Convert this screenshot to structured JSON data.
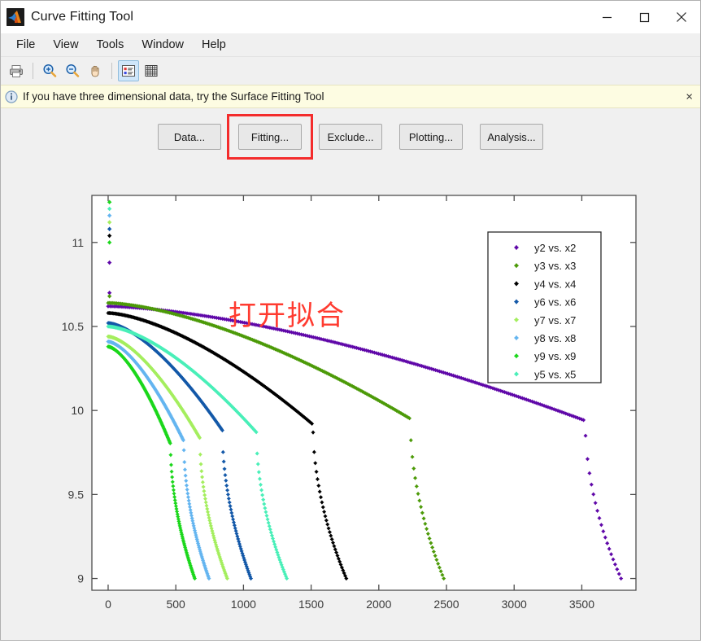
{
  "window": {
    "title": "Curve Fitting Tool",
    "app_icon": "matlab-logo-icon",
    "controls": {
      "minimize": "minimize-icon",
      "maximize": "maximize-icon",
      "close": "close-icon"
    }
  },
  "menubar": {
    "items": [
      {
        "label": "File"
      },
      {
        "label": "View"
      },
      {
        "label": "Tools"
      },
      {
        "label": "Window"
      },
      {
        "label": "Help"
      }
    ]
  },
  "toolbar": {
    "items": [
      {
        "name": "print-icon",
        "title": "Print"
      },
      {
        "name": "zoom-in-icon",
        "title": "Zoom In"
      },
      {
        "name": "zoom-out-icon",
        "title": "Zoom Out"
      },
      {
        "name": "pan-hand-icon",
        "title": "Pan"
      },
      {
        "name": "legend-icon",
        "title": "Legend",
        "active": true
      },
      {
        "name": "grid-icon",
        "title": "Grid"
      }
    ]
  },
  "infobar": {
    "icon": "info-circle-icon",
    "text": "If you have three dimensional data, try the Surface Fitting Tool",
    "close_label": "×"
  },
  "buttons": [
    {
      "label": "Data...",
      "name": "data-button",
      "highlighted": false
    },
    {
      "label": "Fitting...",
      "name": "fitting-button",
      "highlighted": true
    },
    {
      "label": "Exclude...",
      "name": "exclude-button",
      "highlighted": false
    },
    {
      "label": "Plotting...",
      "name": "plotting-button",
      "highlighted": false
    },
    {
      "label": "Analysis...",
      "name": "analysis-button",
      "highlighted": false
    }
  ],
  "annotation": {
    "text": "打开拟合",
    "color": "#ff3b30"
  },
  "chart_data": {
    "type": "scatter",
    "title": "",
    "xlabel": "",
    "ylabel": "",
    "xlim": [
      -120,
      3900
    ],
    "ylim": [
      8.93,
      11.28
    ],
    "xticks": [
      0,
      500,
      1000,
      1500,
      2000,
      2500,
      3000,
      3500
    ],
    "yticks": [
      9,
      9.5,
      10,
      10.5,
      11
    ],
    "grid": false,
    "legend_position": "upper-right",
    "series": [
      {
        "name": "y2 vs. x2",
        "color": "#5F07A8",
        "x_end": 3790,
        "y_start": 10.62,
        "y_end": 9.0,
        "knee": 0.93,
        "points": 260
      },
      {
        "name": "y3 vs. x3",
        "color": "#4C9A08",
        "x_end": 2480,
        "y_start": 10.64,
        "y_end": 9.0,
        "knee": 0.9,
        "points": 235
      },
      {
        "name": "y4 vs. x4",
        "color": "#000000",
        "x_end": 1760,
        "y_start": 10.58,
        "y_end": 9.0,
        "knee": 0.86,
        "points": 215
      },
      {
        "name": "y6 vs. x6",
        "color": "#1358A8",
        "x_end": 1055,
        "y_start": 10.52,
        "y_end": 9.0,
        "knee": 0.8,
        "points": 200
      },
      {
        "name": "y7 vs. x7",
        "color": "#A4EE5E",
        "x_end": 880,
        "y_start": 10.44,
        "y_end": 9.0,
        "knee": 0.77,
        "points": 190
      },
      {
        "name": "y8 vs. x8",
        "color": "#64B5F0",
        "x_end": 745,
        "y_start": 10.41,
        "y_end": 9.0,
        "knee": 0.75,
        "points": 185
      },
      {
        "name": "y9 vs. x9",
        "color": "#1BD71B",
        "x_end": 640,
        "y_start": 10.38,
        "y_end": 9.0,
        "knee": 0.72,
        "points": 180
      },
      {
        "name": "y5 vs. x5",
        "color": "#49EFB8",
        "x_end": 1320,
        "y_start": 10.5,
        "y_end": 9.0,
        "knee": 0.83,
        "points": 205
      }
    ],
    "outlier_points": [
      {
        "series": "y2 vs. x2",
        "x": 10,
        "y": 10.88
      },
      {
        "series": "y2 vs. x2",
        "x": 10,
        "y": 10.7
      },
      {
        "series": "y3 vs. x3",
        "x": 10,
        "y": 10.68
      },
      {
        "series": "y9 vs. x9",
        "x": 10,
        "y": 11.24
      },
      {
        "series": "y5 vs. x5",
        "x": 10,
        "y": 11.2
      },
      {
        "series": "y8 vs. x8",
        "x": 10,
        "y": 11.16
      },
      {
        "series": "y7 vs. x7",
        "x": 10,
        "y": 11.12
      },
      {
        "series": "y6 vs. x6",
        "x": 10,
        "y": 11.08
      },
      {
        "series": "y4 vs. x4",
        "x": 10,
        "y": 11.04
      },
      {
        "series": "y9 vs. x9",
        "x": 10,
        "y": 11.0
      }
    ]
  }
}
